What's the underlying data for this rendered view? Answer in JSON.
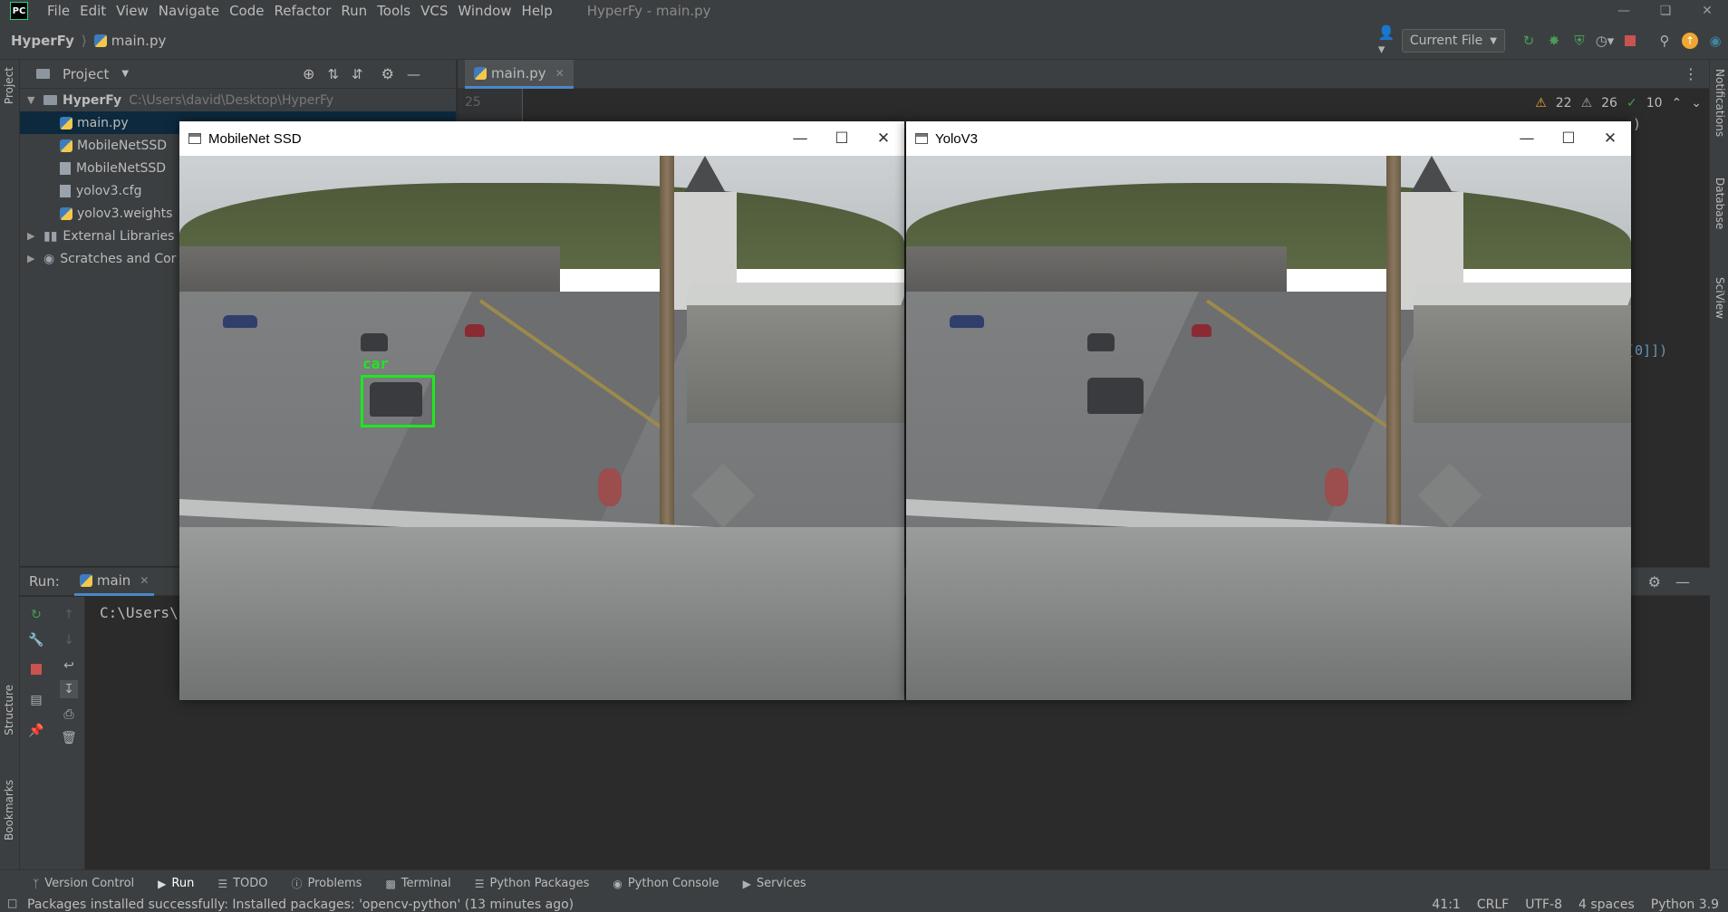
{
  "menubar": {
    "logo": "PC",
    "items": [
      "File",
      "Edit",
      "View",
      "Navigate",
      "Code",
      "Refactor",
      "Run",
      "Tools",
      "VCS",
      "Window",
      "Help"
    ],
    "window_title": "HyperFy - main.py"
  },
  "navbar": {
    "project": "HyperFy",
    "file": "main.py",
    "run_config": "Current File"
  },
  "left_strip": {
    "project": "Project",
    "structure": "Structure",
    "bookmarks": "Bookmarks"
  },
  "right_strip": {
    "notifications": "Notifications",
    "database": "Database",
    "sciview": "SciView"
  },
  "project_panel": {
    "title": "Project",
    "root": {
      "name": "HyperFy",
      "path": "C:\\Users\\david\\Desktop\\HyperFy"
    },
    "files": [
      "main.py",
      "MobileNetSSD",
      "MobileNetSSD",
      "yolov3.cfg",
      "yolov3.weights"
    ],
    "external": "External Libraries",
    "scratches": "Scratches and Cor"
  },
  "editor": {
    "tab": "main.py",
    "line_number": "25",
    "inspections": {
      "warnings": "22",
      "weak_warnings": "26",
      "ok": "10"
    },
    "code_fragment": "[0]])",
    "code_fragment2": ")"
  },
  "run_panel": {
    "label": "Run:",
    "tab": "main",
    "console_line": "C:\\Users\\"
  },
  "bottom_tabs": [
    "Version Control",
    "Run",
    "TODO",
    "Problems",
    "Terminal",
    "Python Packages",
    "Python Console",
    "Services"
  ],
  "status": {
    "message": "Packages installed successfully: Installed packages: 'opencv-python' (13 minutes ago)",
    "position": "41:1",
    "line_sep": "CRLF",
    "encoding": "UTF-8",
    "indent": "4 spaces",
    "interpreter": "Python 3.9"
  },
  "windows": {
    "mobilenet": {
      "title": "MobileNet SSD",
      "detection_label": "car"
    },
    "yolo": {
      "title": "YoloV3"
    }
  },
  "colors": {
    "accent": "#4a88c7",
    "detection": "#1ee81e",
    "warning": "#f0a732"
  }
}
